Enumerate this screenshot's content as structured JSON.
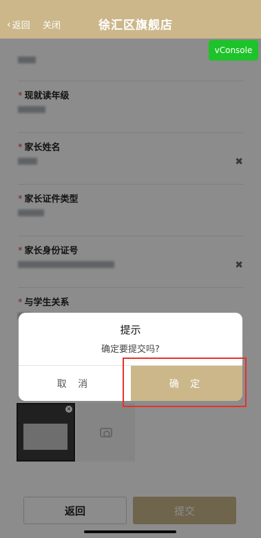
{
  "header": {
    "back_label": "返回",
    "close_label": "关闭",
    "title": "徐汇区旗舰店"
  },
  "vconsole_label": "vConsole",
  "form": {
    "fields": [
      {
        "label": "现就读年级"
      },
      {
        "label": "家长姓名"
      },
      {
        "label": "家长证件类型"
      },
      {
        "label": "家长身份证号"
      },
      {
        "label": "与学生关系"
      }
    ]
  },
  "footer": {
    "back_label": "返回",
    "submit_label": "提交"
  },
  "dialog": {
    "title": "提示",
    "message": "确定要提交吗?",
    "cancel_label": "取 消",
    "confirm_label": "确 定"
  },
  "colors": {
    "brand": "#cbb78a",
    "vconsole": "#1ec32b",
    "required": "#e53935",
    "annotation": "#e8302a"
  },
  "icons": {
    "back": "chevron-left-icon",
    "clear": "close-icon",
    "camera": "camera-icon"
  }
}
